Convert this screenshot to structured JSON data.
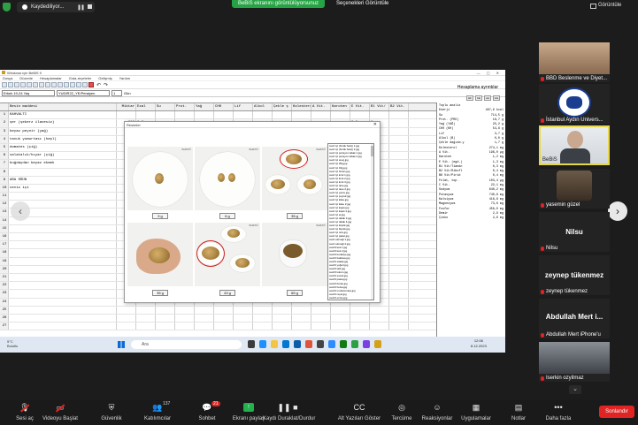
{
  "zoom": {
    "recording_label": "Kaydediliyor...",
    "share_banner": "BeBiS ekranını görüntülüyorsunuz",
    "view_options": "Seçenekleri Görüntüle",
    "view_label": "Görüntüle"
  },
  "app": {
    "title": "Windows için BeBiS 9",
    "menu": [
      "Dosya",
      "Düzenle",
      "Hesaplamalar",
      "Gıda-reçeteler",
      "Gelişmiş",
      "Yardım"
    ],
    "combo_group": "Erkek 19-24 Yaş",
    "combo_file": "YUDIR22_YE/Peraiyen",
    "combo_num": "1",
    "combo_day": "Gün",
    "results_title": "Hesaplama ayrıntılar",
    "mini_buttons": [
      "HF",
      "FE",
      "AA",
      "GG"
    ]
  },
  "grid": {
    "headers": [
      "Besin maddesi",
      "Miktar",
      "Ezal",
      "Su",
      "Prot.",
      "Yağ",
      "CH0",
      "Lif",
      "Alkol",
      "Çekle ş",
      "Kolesterol",
      "A Vit.",
      "Karoten",
      "E Vit.",
      "Bl Vit/",
      "B2 Vit."
    ],
    "rows": [
      {
        "n": "1",
        "name": "KAHVALTI",
        "qty": "",
        "v1": "",
        "v2": "",
        "v3": ""
      },
      {
        "n": "2",
        "name": "şer (şekerz ilavesiz)",
        "qty": "200",
        "v1": "0,3",
        "v2": "0,0",
        "v3": "0,"
      },
      {
        "n": "3",
        "name": "beyaz peynir (yağ)",
        "qty": "55",
        "v1": "",
        "v2": "0,9",
        "v3": "0,"
      },
      {
        "n": "4",
        "name": "tavuk yumurtası (haşl)",
        "qty": "60",
        "v1": "",
        "v2": "1,2",
        "v3": "0,"
      },
      {
        "n": "5",
        "name": "domates (çiğ)",
        "qty": "120",
        "v1": "",
        "v2": "1,5",
        "v3": "0,"
      },
      {
        "n": "6",
        "name": "salatalık/hıyar (çiğ)",
        "qty": "100",
        "v1": "",
        "v2": "0,2",
        "v3": "0,"
      },
      {
        "n": "7",
        "name": "buğdaydan beyaz ekmek",
        "qty": "50",
        "v1": "",
        "v2": "0,4",
        "v3": "0,"
      },
      {
        "n": "8",
        "name": "",
        "qty": "",
        "v1": "",
        "v2": "",
        "v3": ""
      },
      {
        "n": "9",
        "name": "ARA ÖĞÜN",
        "qty": "",
        "v1": "",
        "v2": "",
        "v3": ""
      },
      {
        "n": "10",
        "name": "ceviz içi",
        "qty": "",
        "v1": "",
        "v2": "",
        "v3": ""
      },
      {
        "n": "11",
        "name": "",
        "qty": "",
        "v1": "",
        "v2": "",
        "v3": ""
      },
      {
        "n": "12",
        "name": "",
        "qty": "",
        "v1": "",
        "v2": "",
        "v3": ""
      },
      {
        "n": "13",
        "name": "",
        "qty": "",
        "v1": "",
        "v2": "",
        "v3": ""
      },
      {
        "n": "14",
        "name": "",
        "qty": "",
        "v1": "",
        "v2": "",
        "v3": ""
      },
      {
        "n": "15",
        "name": "",
        "qty": "",
        "v1": "",
        "v2": "",
        "v3": ""
      },
      {
        "n": "16",
        "name": "",
        "qty": "",
        "v1": "",
        "v2": "",
        "v3": ""
      },
      {
        "n": "17",
        "name": "",
        "qty": "",
        "v1": "",
        "v2": "",
        "v3": ""
      },
      {
        "n": "18",
        "name": "",
        "qty": "",
        "v1": "",
        "v2": "",
        "v3": ""
      },
      {
        "n": "19",
        "name": "",
        "qty": "",
        "v1": "",
        "v2": "",
        "v3": ""
      },
      {
        "n": "20",
        "name": "",
        "qty": "",
        "v1": "",
        "v2": "",
        "v3": ""
      },
      {
        "n": "21",
        "name": "",
        "qty": "",
        "v1": "",
        "v2": "",
        "v3": ""
      },
      {
        "n": "22",
        "name": "",
        "qty": "",
        "v1": "",
        "v2": "",
        "v3": ""
      },
      {
        "n": "23",
        "name": "",
        "qty": "",
        "v1": "",
        "v2": "",
        "v3": ""
      },
      {
        "n": "24",
        "name": "",
        "qty": "",
        "v1": "",
        "v2": "",
        "v3": ""
      },
      {
        "n": "25",
        "name": "",
        "qty": "",
        "v1": "",
        "v2": "",
        "v3": ""
      },
      {
        "n": "26",
        "name": "",
        "qty": "",
        "v1": "",
        "v2": "",
        "v3": ""
      },
      {
        "n": "27",
        "name": "",
        "qty": "",
        "v1": "",
        "v2": "",
        "v3": ""
      }
    ]
  },
  "results_panel": {
    "title": "Toplu analiz",
    "lines": [
      [
        "Enerji",
        "487,9 kcal"
      ],
      [
        "Su",
        "714,5 g"
      ],
      [
        "Prot. (PRO)",
        "18,7 g"
      ],
      [
        "Yağ (YAĞ)",
        "25,2 g"
      ],
      [
        "CH0 (KH)",
        "54,8 g"
      ],
      [
        "Lif",
        "3,7 g"
      ],
      [
        "Alkol (B)",
        "0,0 g"
      ],
      [
        "Çekle dağısm.y",
        "1,7 g"
      ],
      [
        "Kolesterol",
        "274,1 mg"
      ],
      [
        "A Vit.",
        "196,0 µg"
      ],
      [
        "Karoten",
        "1,2 mg"
      ],
      [
        "E Vit. (egd.)",
        "1,3 mg"
      ],
      [
        "B1 Vit/Tiamin",
        "0,3 mg"
      ],
      [
        "B2 Vit/Ribofl",
        "0,4 mg"
      ],
      [
        "B6 Vit/Pirid",
        "0,4 mg"
      ],
      [
        "Folat, top.",
        "103,4 µg"
      ],
      [
        "C Vit.",
        "22,1 mg"
      ],
      [
        "Sodyum",
        "840,2 mg"
      ],
      [
        "Potasyum",
        "740,8 mg"
      ],
      [
        "Kalsiyum",
        "416,8 mg"
      ],
      [
        "Magnezyum",
        "73,6 mg"
      ],
      [
        "Fosfor",
        "456,0 mg"
      ],
      [
        "Demir",
        "2,9 mg"
      ],
      [
        "Çinko",
        "2,6 mg"
      ]
    ]
  },
  "popup": {
    "title": "Resimler",
    "watermark": "BeBiS®",
    "grams": [
      "9 g",
      "6 g",
      "35 g",
      "35 g",
      "43 g",
      "65 g"
    ],
    "files": [
      "ceviz içi (fındık hariç) 1.jpg",
      "ceviz içi (fındık hariç) 2.jpg",
      "ceviz içi porsiyon tabak 1.jpg",
      "ceviz içi porsiyon tabak 2.jpg",
      "ceviz içi avuç.jpg",
      "ceviz içi 35g.jpg",
      "ceviz içi 43g.jpg",
      "ceviz içi fincan.jpg",
      "ceviz içi kırık 1.jpg",
      "ceviz içi kırık 2.jpg",
      "ceviz içi kırık 3.jpg",
      "ceviz içi tane.jpg",
      "ceviz içi tane 2.jpg",
      "ceviz içi yarım.jpg",
      "ceviz içi çeyrek.jpg",
      "ceviz içi kâse.jpg",
      "ceviz içi kâse 2.jpg",
      "ceviz içi kaşık.jpg",
      "ceviz içi kaşık 2.jpg",
      "ceviz içi el.jpg",
      "ceviz içi tabak 3.jpg",
      "ceviz içi tabak 4.jpg",
      "ceviz içi küçük.jpg",
      "ceviz içi büyük.jpg",
      "ceviz içi orta.jpg",
      "ceviz içi paket.jpg",
      "ceviz ekmeği 1.jpg",
      "ceviz ekmeği 2.jpg",
      "cevizli kek 1.jpg",
      "cevizli kek 2.jpg",
      "cevizli kurabiye.jpg",
      "cevizli baklava.jpg",
      "cevizli salata.jpg",
      "cevizli yoğurt.jpg",
      "cevizli tatlı.jpg",
      "cevizli lokum.jpg",
      "cevizli sucuk.jpg",
      "cevizli pasta.jpg",
      "cevizli börek.jpg",
      "cevizli helva.jpg",
      "cevizli muhammara.jpg",
      "cevizli reçel.jpg",
      "cevizli ezme.jpg"
    ]
  },
  "taskbar": {
    "weather_temp": "5°C",
    "weather_text": "Bulutlu",
    "search_placeholder": "Ara",
    "time": "12:06",
    "date": "8.12.2023"
  },
  "participants": [
    {
      "name": "BBD Beslenme ve Diyet...",
      "type": "photo",
      "muted": true
    },
    {
      "name": "İstanbul Aydın Univers...",
      "type": "logo",
      "muted": true
    },
    {
      "name": "BeBiS",
      "type": "video",
      "muted": false,
      "active": true
    },
    {
      "name": "yasemin güzel",
      "type": "photo",
      "muted": true
    },
    {
      "name": "Nilsu",
      "type": "name",
      "big": "Nilsu",
      "muted": true
    },
    {
      "name": "zeynep tükenmez",
      "type": "name",
      "big": "zeynep tükenmez",
      "muted": true
    },
    {
      "name": "Abdullah Mert iPhone'u",
      "type": "name",
      "big": "Abdullah Mert i...",
      "muted": true
    },
    {
      "name": "Iserkin ozyilmaz",
      "type": "photo",
      "muted": true
    }
  ],
  "bottom_bar": {
    "items": [
      {
        "label": "Sesi aç",
        "icon": "microphone-muted"
      },
      {
        "label": "Videoyu Başlat",
        "icon": "camera-off"
      },
      {
        "label": "Güvenlik",
        "icon": "shield"
      },
      {
        "label": "Katılımcılar",
        "icon": "people",
        "count": "137"
      },
      {
        "label": "Sohbet",
        "icon": "chat",
        "badge": "21"
      },
      {
        "label": "Ekranı paylaş",
        "icon": "share-screen"
      },
      {
        "label": "Kaydı Duraklat/Durdur",
        "icon": "pause-stop"
      },
      {
        "label": "Alt Yazıları Göster",
        "icon": "captions"
      },
      {
        "label": "Tercüme",
        "icon": "globe"
      },
      {
        "label": "Reaksiyonlar",
        "icon": "reaction"
      },
      {
        "label": "Uygulamalar",
        "icon": "apps"
      },
      {
        "label": "Notlar",
        "icon": "notes"
      },
      {
        "label": "Daha fazla",
        "icon": "more"
      }
    ],
    "end_label": "Sonlandır"
  }
}
